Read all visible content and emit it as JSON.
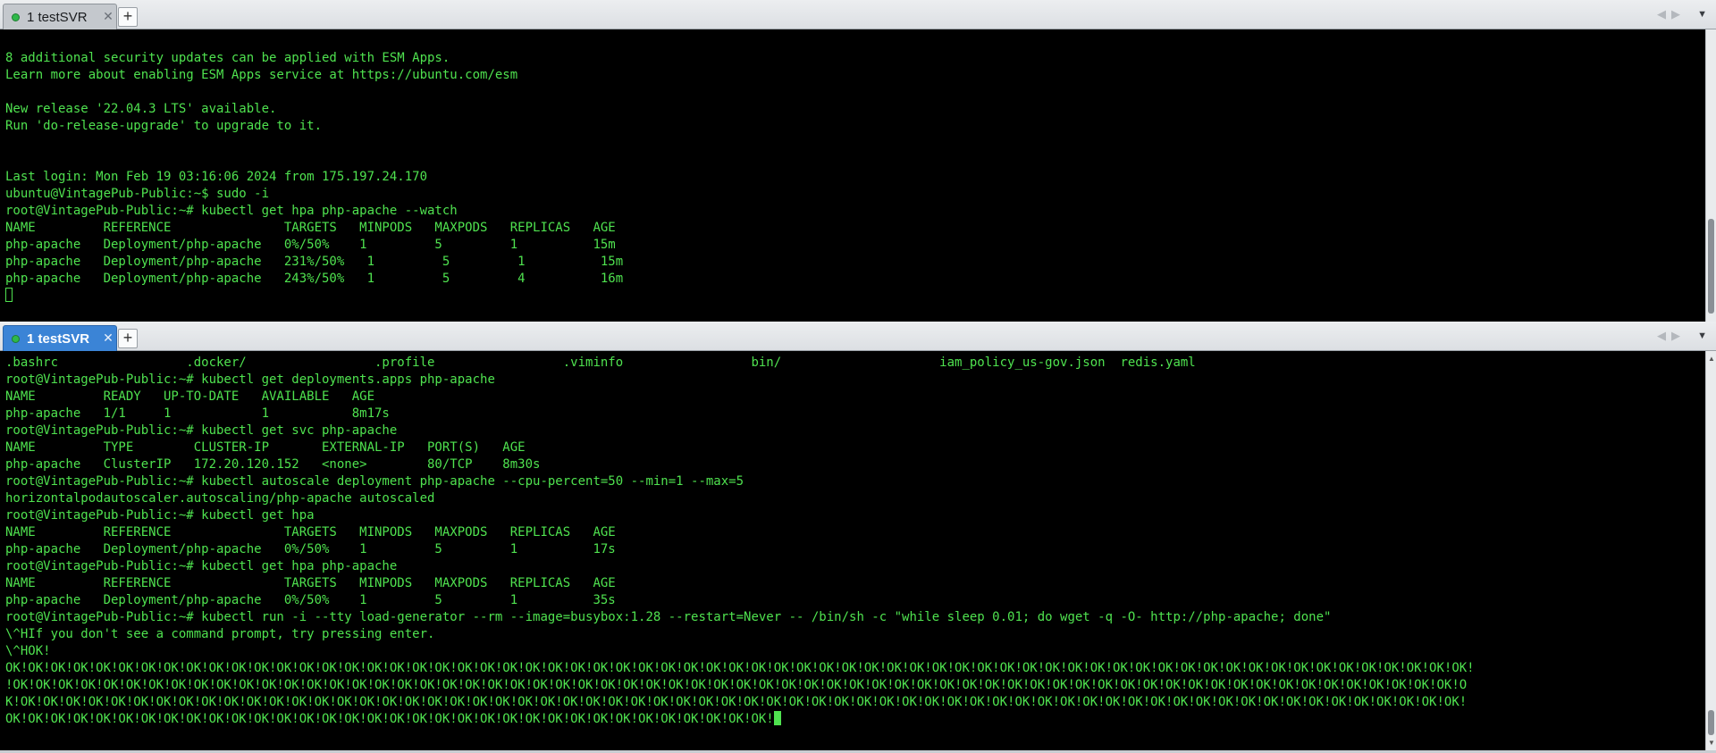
{
  "panes": {
    "top": {
      "tab_title": "1 testSVR",
      "tab_active": false,
      "lines": [
        "8 additional security updates can be applied with ESM Apps.",
        "Learn more about enabling ESM Apps service at https://ubuntu.com/esm",
        "",
        "New release '22.04.3 LTS' available.",
        "Run 'do-release-upgrade' to upgrade to it.",
        "",
        "",
        "Last login: Mon Feb 19 03:16:06 2024 from 175.197.24.170",
        "ubuntu@VintagePub-Public:~$ sudo -i",
        "root@VintagePub-Public:~# kubectl get hpa php-apache --watch",
        "NAME         REFERENCE               TARGETS   MINPODS   MAXPODS   REPLICAS   AGE",
        "php-apache   Deployment/php-apache   0%/50%    1         5         1          15m",
        "php-apache   Deployment/php-apache   231%/50%   1         5         1          15m",
        "php-apache   Deployment/php-apache   243%/50%   1         5         4          16m"
      ],
      "cursor_style": "outline"
    },
    "bottom": {
      "tab_title": "1 testSVR",
      "tab_active": true,
      "lines": [
        ".bashrc                 .docker/                 .profile                 .viminfo                 bin/                     iam_policy_us-gov.json  redis.yaml",
        "root@VintagePub-Public:~# kubectl get deployments.apps php-apache",
        "NAME         READY   UP-TO-DATE   AVAILABLE   AGE",
        "php-apache   1/1     1            1           8m17s",
        "root@VintagePub-Public:~# kubectl get svc php-apache",
        "NAME         TYPE        CLUSTER-IP       EXTERNAL-IP   PORT(S)   AGE",
        "php-apache   ClusterIP   172.20.120.152   <none>        80/TCP    8m30s",
        "root@VintagePub-Public:~# kubectl autoscale deployment php-apache --cpu-percent=50 --min=1 --max=5",
        "horizontalpodautoscaler.autoscaling/php-apache autoscaled",
        "root@VintagePub-Public:~# kubectl get hpa",
        "NAME         REFERENCE               TARGETS   MINPODS   MAXPODS   REPLICAS   AGE",
        "php-apache   Deployment/php-apache   0%/50%    1         5         1          17s",
        "root@VintagePub-Public:~# kubectl get hpa php-apache",
        "NAME         REFERENCE               TARGETS   MINPODS   MAXPODS   REPLICAS   AGE",
        "php-apache   Deployment/php-apache   0%/50%    1         5         1          35s",
        "root@VintagePub-Public:~# kubectl run -i --tty load-generator --rm --image=busybox:1.28 --restart=Never -- /bin/sh -c \"while sleep 0.01; do wget -q -O- http://php-apache; done\"",
        "\\^HIf you don't see a command prompt, try pressing enter.",
        "\\^HOK!",
        "OK!OK!OK!OK!OK!OK!OK!OK!OK!OK!OK!OK!OK!OK!OK!OK!OK!OK!OK!OK!OK!OK!OK!OK!OK!OK!OK!OK!OK!OK!OK!OK!OK!OK!OK!OK!OK!OK!OK!OK!OK!OK!OK!OK!OK!OK!OK!OK!OK!OK!OK!OK!OK!OK!OK!OK!OK!OK!OK!OK!OK!OK!OK!OK!OK!",
        "!OK!OK!OK!OK!OK!OK!OK!OK!OK!OK!OK!OK!OK!OK!OK!OK!OK!OK!OK!OK!OK!OK!OK!OK!OK!OK!OK!OK!OK!OK!OK!OK!OK!OK!OK!OK!OK!OK!OK!OK!OK!OK!OK!OK!OK!OK!OK!OK!OK!OK!OK!OK!OK!OK!OK!OK!OK!OK!OK!OK!OK!OK!OK!OK!O",
        "K!OK!OK!OK!OK!OK!OK!OK!OK!OK!OK!OK!OK!OK!OK!OK!OK!OK!OK!OK!OK!OK!OK!OK!OK!OK!OK!OK!OK!OK!OK!OK!OK!OK!OK!OK!OK!OK!OK!OK!OK!OK!OK!OK!OK!OK!OK!OK!OK!OK!OK!OK!OK!OK!OK!OK!OK!OK!OK!OK!OK!OK!OK!OK!OK!",
        "OK!OK!OK!OK!OK!OK!OK!OK!OK!OK!OK!OK!OK!OK!OK!OK!OK!OK!OK!OK!OK!OK!OK!OK!OK!OK!OK!OK!OK!OK!OK!OK!OK!OK!"
      ],
      "cursor_style": "solid"
    }
  },
  "icons": {
    "tab_status": "green-status-dot",
    "tab_close": "✕",
    "tab_new": "+",
    "nav_prev": "◀",
    "nav_next": "▶",
    "menu": "▼",
    "scroll_up": "▲",
    "scroll_down": "▼"
  },
  "colors": {
    "terminal_fg": "#4fe24f",
    "terminal_bg": "#000000",
    "active_tab": "#3b84d6"
  }
}
